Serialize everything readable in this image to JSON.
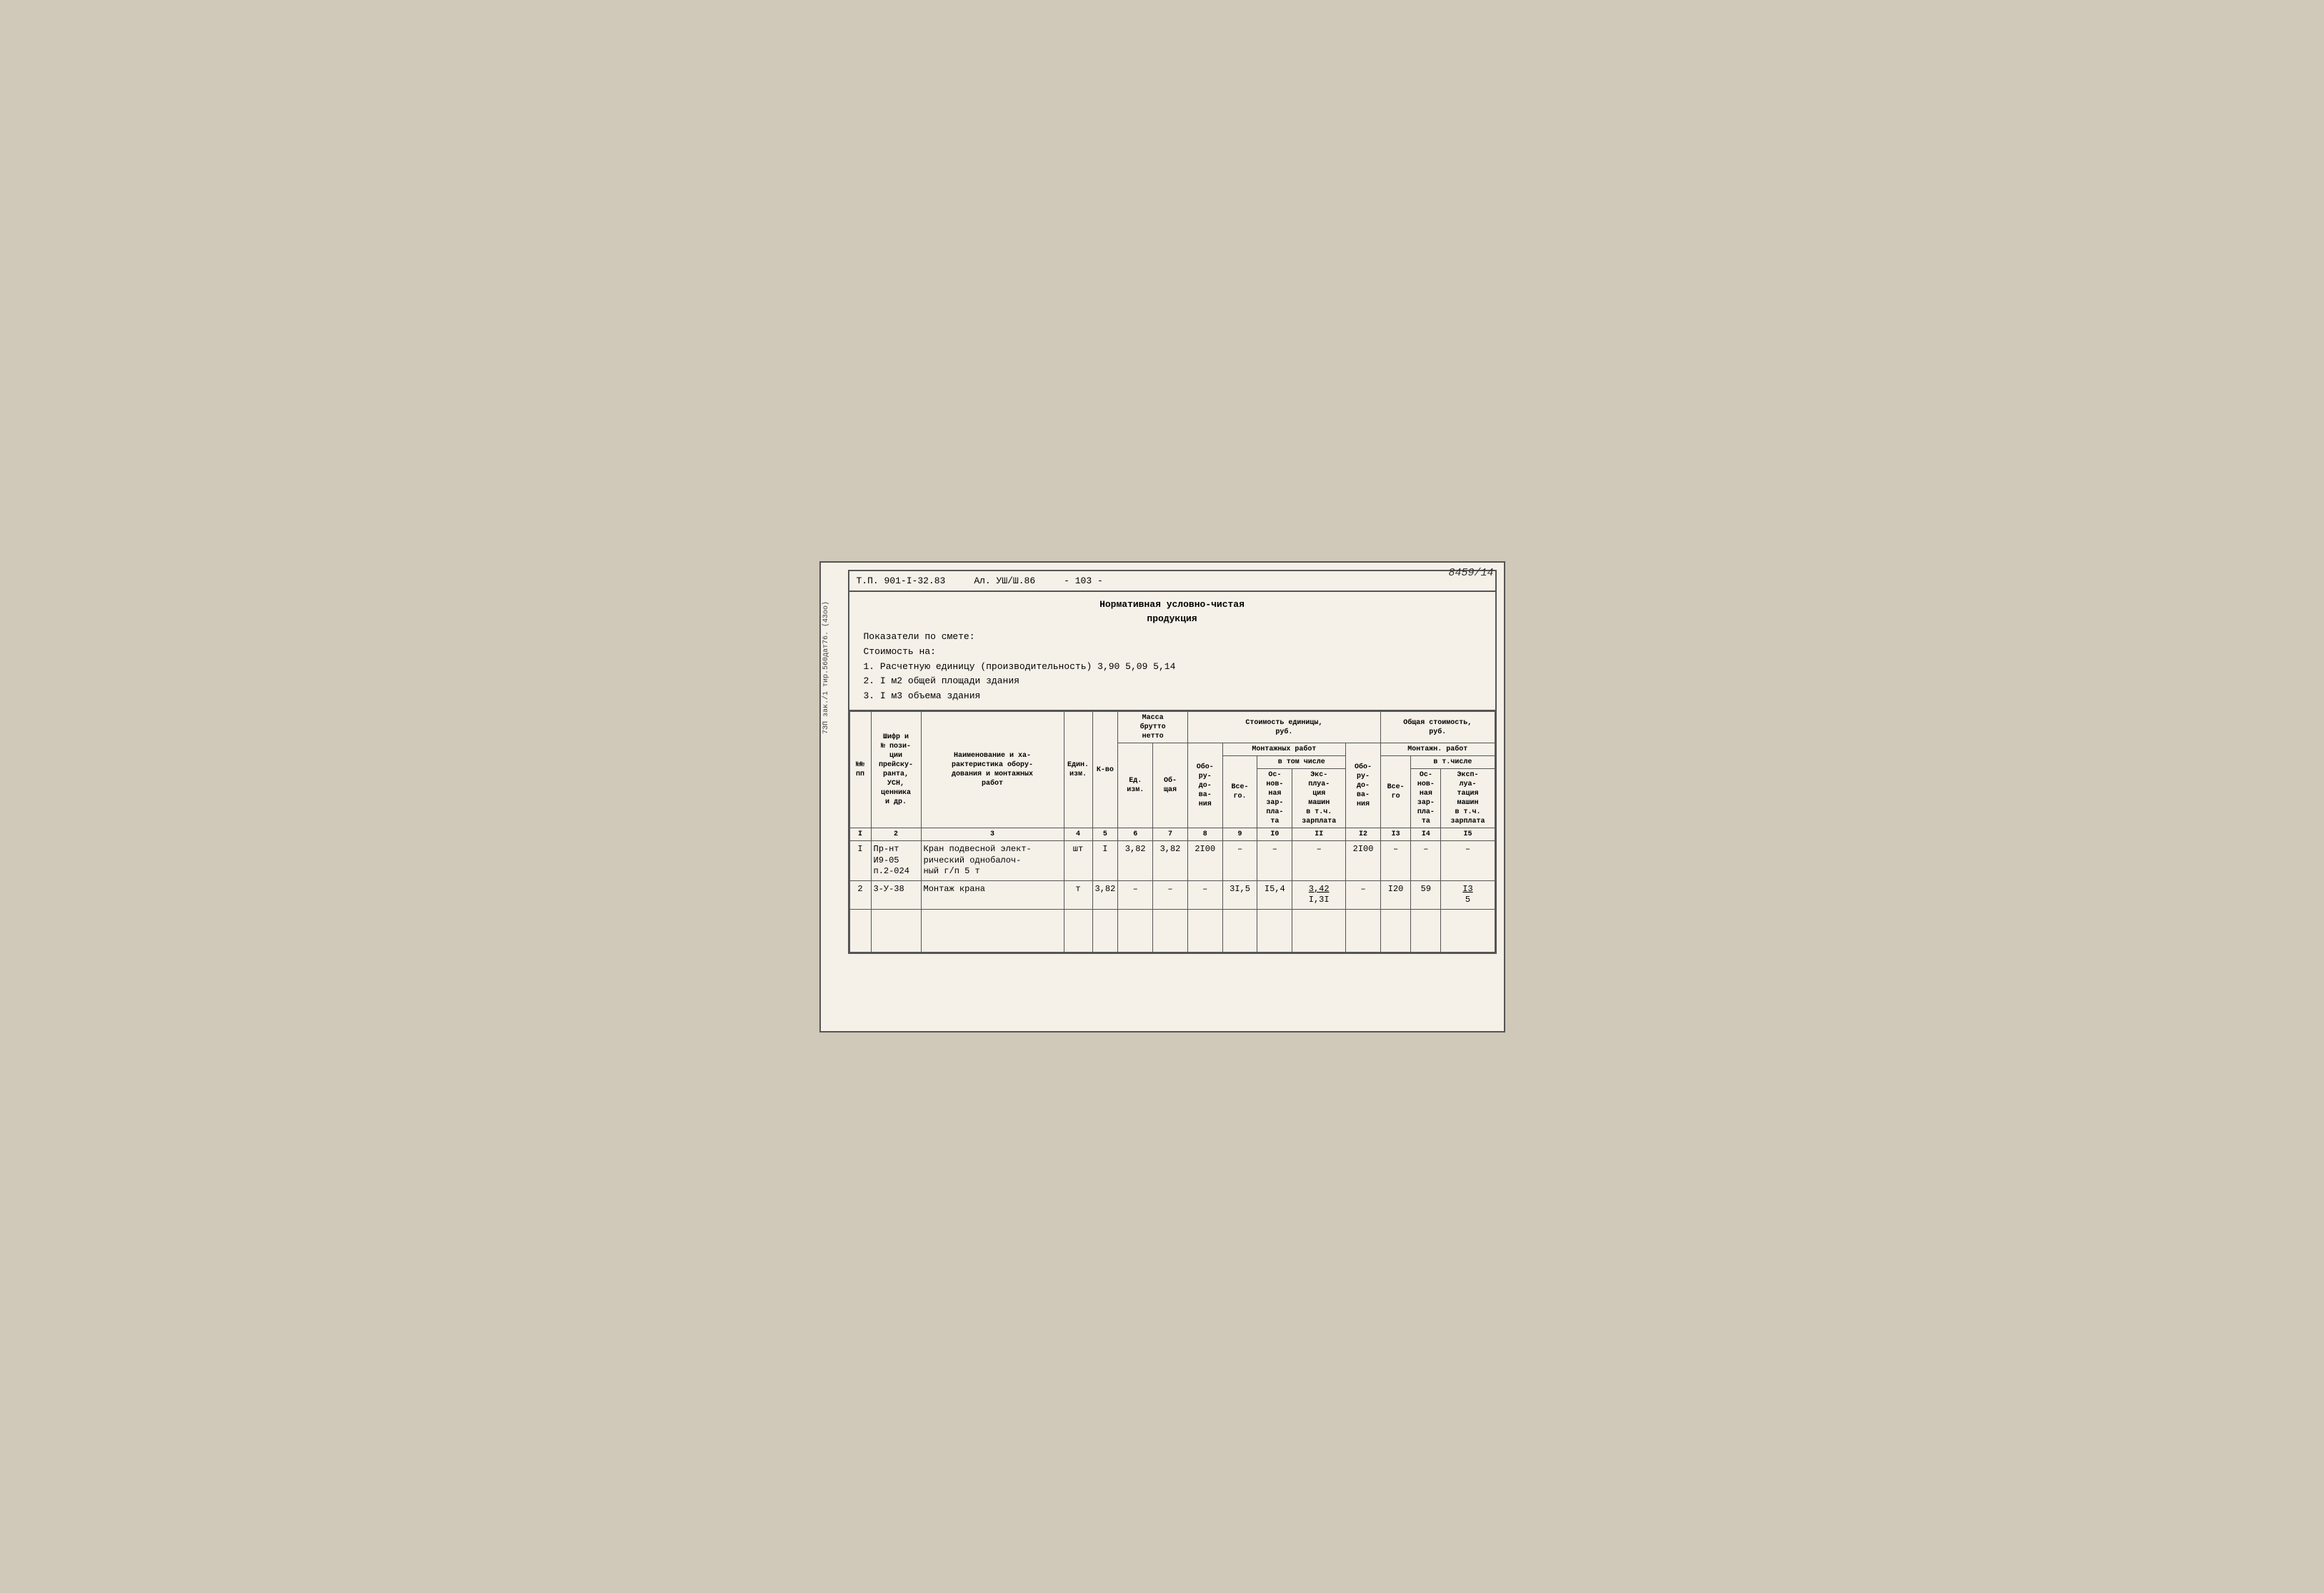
{
  "page": {
    "number": "8459/14",
    "side_text": "7ЗП зак./1 тир.560дат76. (43oo)"
  },
  "header": {
    "tp": "Т.П. 901-I-32.83",
    "al": "Ал. УШ/Ш.86",
    "num": "- 103 -"
  },
  "info": {
    "line1": "Нормативная условно-чистая",
    "line2": "продукция",
    "line3": "Показатели по смете:",
    "line4": "Стоимость на:",
    "line5": "1. Расчетную единицу (производительность)  3,90    5,09    5,14",
    "line6": "2. I м2 общей площади здания",
    "line7": "3. I м3 объема здания"
  },
  "table": {
    "col_headers_row1": [
      "№№ пп",
      "Шифр и № пози-ции прейску-ранта, УСН, ценника и др.",
      "Наименование и характеристика оборудования и монтажных работ",
      "Един. изм.",
      "К-во",
      "Масса брутто нетто",
      "",
      "Оборудо-вания",
      "Монтажных работ",
      "",
      "",
      "Оборудо-вания",
      "Монтажн. работ",
      "",
      ""
    ],
    "col_headers_mass": [
      "Ед. изм.",
      "Об-щая"
    ],
    "col_headers_stoimost": [
      "Стоимость единицы, руб.",
      "Общая стоимость, руб."
    ],
    "col_headers_montazh": [
      "Все-го",
      "в том числе",
      "",
      ""
    ],
    "col_headers_montazh_sub": [
      "Ос-нов-ная зар-пла-та",
      "Экс-плуа-тация машин в т.ч. зарплата"
    ],
    "col_headers_montazh2": [
      "Все-го",
      "в т.числе",
      "",
      ""
    ],
    "col_headers_montazh2_sub": [
      "Ос-нов-ная зар-пла-та",
      "Эксп-луа-тация машин в т.ч. зарплата"
    ],
    "col_numbers": [
      "1",
      "2",
      "3",
      "4",
      "5",
      "6",
      "7",
      "8",
      "9",
      "10",
      "11",
      "12",
      "13",
      "14",
      "15"
    ],
    "rows": [
      {
        "num": "I",
        "shifr": "Пр-нт И9-05 п.2-024",
        "name": "Кран подвесной электрический однобалочный г/п 5 т",
        "ed": "шт",
        "kvo": "I",
        "mass_ed": "3,82",
        "mass_ob": "3,82",
        "obo": "2100",
        "vsego": "–",
        "osnov": "–",
        "expl": "–",
        "obo2": "2100",
        "vsego2": "–",
        "osnov2": "–",
        "expl2": "–"
      },
      {
        "num": "2",
        "shifr": "3-У-38",
        "name": "Монтаж крана",
        "ed": "т",
        "kvo": "3,82",
        "mass_ed": "–",
        "mass_ob": "–",
        "obo": "–",
        "vsego": "31,5",
        "osnov": "15,4",
        "expl": "3,42\nI,3I",
        "obo2": "–",
        "vsego2": "I20",
        "osnov2": "59",
        "expl2": "I3\n5"
      }
    ]
  }
}
